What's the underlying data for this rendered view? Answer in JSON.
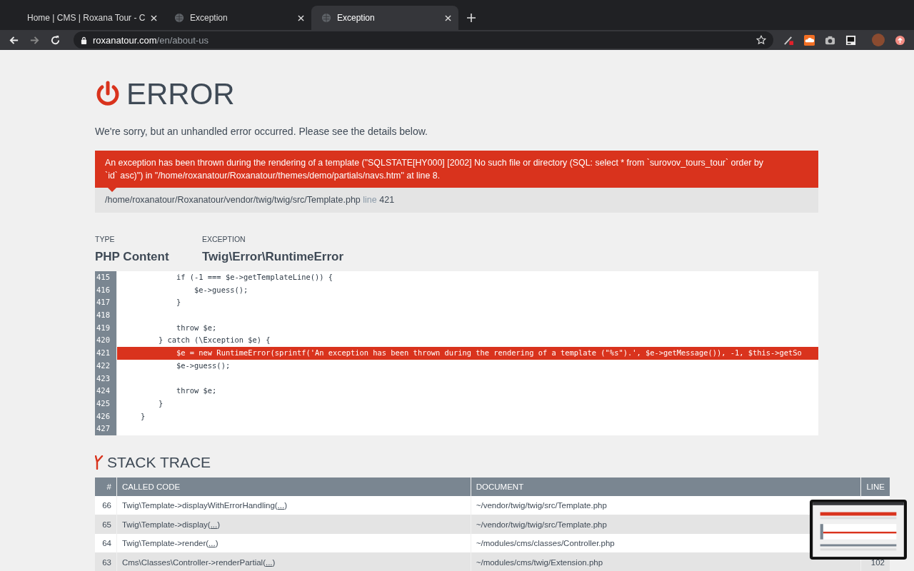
{
  "browser": {
    "tabs": [
      {
        "title": "Home | CMS | Roxana Tour - C",
        "selected": false
      },
      {
        "title": "Exception",
        "selected": false
      },
      {
        "title": "Exception",
        "selected": true
      }
    ],
    "url": {
      "host": "roxanatour.com",
      "path": "/en/about-us"
    }
  },
  "page": {
    "heading": "ERROR",
    "intro": "We're sorry, but an unhandled error occurred. Please see the details below.",
    "message": "An exception has been thrown during the rendering of a template (\"SQLSTATE[HY000] [2002] No such file or directory (SQL: select * from `surovov_tours_tour` order by `id` asc)\") in \"/home/roxanatour/Roxanatour/themes/demo/partials/navs.htm\" at line 8.",
    "file": {
      "path": "/home/roxanatour/Roxanatour/vendor/twig/twig/src/Template.php",
      "line_label": "line",
      "line": "421"
    },
    "type": {
      "label": "TYPE",
      "value": "PHP Content"
    },
    "exception": {
      "label": "EXCEPTION",
      "value": "Twig\\Error\\RuntimeError"
    },
    "code": [
      {
        "number": "415",
        "text": "            if (-1 === $e->getTemplateLine()) {",
        "selected": false
      },
      {
        "number": "416",
        "text": "                $e->guess();",
        "selected": false
      },
      {
        "number": "417",
        "text": "            }",
        "selected": false
      },
      {
        "number": "418",
        "selected": false
      },
      {
        "number": "419",
        "text": "            throw $e;",
        "selected": false
      },
      {
        "number": "420",
        "text": "        } catch (\\Exception $e) {",
        "selected": false
      },
      {
        "number": "421",
        "text": "            $e = new RuntimeError(sprintf('An exception has been thrown during the rendering of a template (\"%s\").', $e->getMessage()), -1, $this->getSo",
        "selected": true
      },
      {
        "number": "422",
        "text": "            $e->guess();",
        "selected": false
      },
      {
        "number": "423",
        "selected": false
      },
      {
        "number": "424",
        "text": "            throw $e;",
        "selected": false
      },
      {
        "number": "425",
        "text": "        }",
        "selected": false
      },
      {
        "number": "426",
        "text": "    }",
        "selected": false
      },
      {
        "number": "427",
        "selected": false
      }
    ],
    "stack_trace": {
      "heading": "STACK TRACE",
      "columns": [
        "#",
        "CALLED CODE",
        "DOCUMENT",
        "LINE"
      ],
      "rows": [
        {
          "number": "66",
          "code": "Twig\\Template->displayWithErrorHandling(",
          "args": "...",
          "code_end": ")",
          "document": "~/vendor/twig/twig/src/Template.php"
        },
        {
          "number": "65",
          "code": "Twig\\Template->display(",
          "args": "...",
          "code_end": ")",
          "document": "~/vendor/twig/twig/src/Template.php"
        },
        {
          "number": "64",
          "code": "Twig\\Template->render(",
          "args": "...",
          "code_end": ")",
          "document": "~/modules/cms/classes/Controller.php"
        },
        {
          "number": "63",
          "code": "Cms\\Classes\\Controller->renderPartial(",
          "args": "...",
          "code_end": ")",
          "document": "~/modules/cms/twig/Extension.php",
          "line": "102"
        }
      ]
    }
  }
}
